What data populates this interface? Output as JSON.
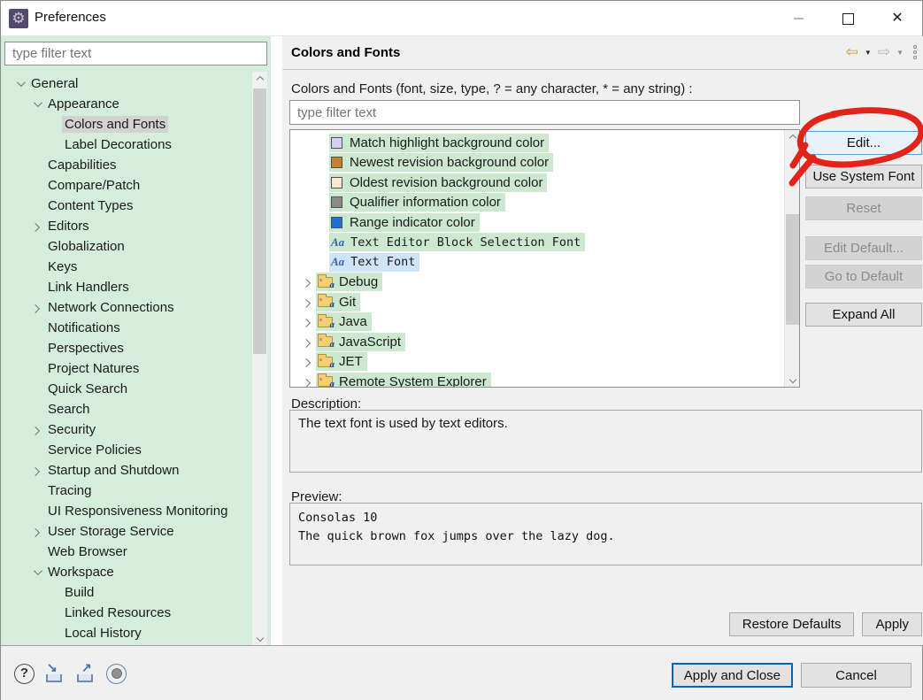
{
  "titlebar": {
    "title": "Preferences",
    "app_icon_glyph": "⚙",
    "close_glyph": "✕"
  },
  "sidebar": {
    "filter_placeholder": "type filter text",
    "tree": [
      {
        "label": "General",
        "level": 0,
        "state": "expanded",
        "selected": false
      },
      {
        "label": "Appearance",
        "level": 1,
        "state": "expanded",
        "selected": false
      },
      {
        "label": "Colors and Fonts",
        "level": 2,
        "state": "none",
        "selected": true
      },
      {
        "label": "Label Decorations",
        "level": 2,
        "state": "none",
        "selected": false
      },
      {
        "label": "Capabilities",
        "level": 1,
        "state": "none",
        "selected": false
      },
      {
        "label": "Compare/Patch",
        "level": 1,
        "state": "none",
        "selected": false
      },
      {
        "label": "Content Types",
        "level": 1,
        "state": "none",
        "selected": false
      },
      {
        "label": "Editors",
        "level": 1,
        "state": "collapsed",
        "selected": false
      },
      {
        "label": "Globalization",
        "level": 1,
        "state": "none",
        "selected": false
      },
      {
        "label": "Keys",
        "level": 1,
        "state": "none",
        "selected": false
      },
      {
        "label": "Link Handlers",
        "level": 1,
        "state": "none",
        "selected": false
      },
      {
        "label": "Network Connections",
        "level": 1,
        "state": "collapsed",
        "selected": false
      },
      {
        "label": "Notifications",
        "level": 1,
        "state": "none",
        "selected": false
      },
      {
        "label": "Perspectives",
        "level": 1,
        "state": "none",
        "selected": false
      },
      {
        "label": "Project Natures",
        "level": 1,
        "state": "none",
        "selected": false
      },
      {
        "label": "Quick Search",
        "level": 1,
        "state": "none",
        "selected": false
      },
      {
        "label": "Search",
        "level": 1,
        "state": "none",
        "selected": false
      },
      {
        "label": "Security",
        "level": 1,
        "state": "collapsed",
        "selected": false
      },
      {
        "label": "Service Policies",
        "level": 1,
        "state": "none",
        "selected": false
      },
      {
        "label": "Startup and Shutdown",
        "level": 1,
        "state": "collapsed",
        "selected": false
      },
      {
        "label": "Tracing",
        "level": 1,
        "state": "none",
        "selected": false
      },
      {
        "label": "UI Responsiveness Monitoring",
        "level": 1,
        "state": "none",
        "selected": false
      },
      {
        "label": "User Storage Service",
        "level": 1,
        "state": "collapsed",
        "selected": false
      },
      {
        "label": "Web Browser",
        "level": 1,
        "state": "none",
        "selected": false
      },
      {
        "label": "Workspace",
        "level": 1,
        "state": "expanded",
        "selected": false
      },
      {
        "label": "Build",
        "level": 2,
        "state": "none",
        "selected": false
      },
      {
        "label": "Linked Resources",
        "level": 2,
        "state": "none",
        "selected": false
      },
      {
        "label": "Local History",
        "level": 2,
        "state": "none",
        "selected": false
      }
    ]
  },
  "content": {
    "page_title": "Colors and Fonts",
    "toolbar": {
      "back_glyph": "⇦",
      "forward_glyph": "⇨",
      "dropdown_glyph": "▼"
    },
    "filter_label": "Colors and Fonts (font, size, type, ? = any character, * = any string) :",
    "filter_placeholder": "type filter text",
    "font_icon_glyph": "Aa",
    "folder_badge": "a",
    "list": [
      {
        "type": "color",
        "label": "Match highlight background color",
        "swatch": "#d7cef2",
        "highlight": "green"
      },
      {
        "type": "color",
        "label": "Newest revision background color",
        "swatch": "#c4802c",
        "highlight": "green"
      },
      {
        "type": "color",
        "label": "Oldest revision background color",
        "swatch": "#f9e9d2",
        "highlight": "green"
      },
      {
        "type": "color",
        "label": "Qualifier information color",
        "swatch": "#8a8a8a",
        "highlight": "green"
      },
      {
        "type": "color",
        "label": "Range indicator color",
        "swatch": "#1c72d4",
        "highlight": "green"
      },
      {
        "type": "font",
        "label": "Text Editor Block Selection Font",
        "highlight": "green"
      },
      {
        "type": "font",
        "label": "Text Font",
        "highlight": "blue"
      },
      {
        "type": "category",
        "label": "Debug",
        "highlight": "green"
      },
      {
        "type": "category",
        "label": "Git",
        "highlight": "green"
      },
      {
        "type": "category",
        "label": "Java",
        "highlight": "green"
      },
      {
        "type": "category",
        "label": "JavaScript",
        "highlight": "green"
      },
      {
        "type": "category",
        "label": "JET",
        "highlight": "green"
      },
      {
        "type": "category",
        "label": "Remote System Explorer",
        "highlight": "green"
      }
    ],
    "side_buttons": [
      {
        "label": "Edit...",
        "style": "focus"
      },
      {
        "label": "Use System Font",
        "style": "normal"
      },
      {
        "label": "Reset",
        "style": "disabled"
      },
      {
        "label": "Edit Default...",
        "style": "disabled"
      },
      {
        "label": "Go to Default",
        "style": "disabled"
      },
      {
        "label": "Expand All",
        "style": "normal"
      }
    ],
    "description_label": "Description:",
    "description_text": "The text font is used by text editors.",
    "preview_label": "Preview:",
    "preview_lines": [
      "Consolas 10",
      "The quick brown fox jumps over the lazy dog."
    ],
    "footer_buttons": [
      {
        "label": "Restore Defaults"
      },
      {
        "label": "Apply"
      }
    ]
  },
  "bottom_bar": {
    "help_glyph": "?",
    "import_glyph": "↘",
    "export_glyph": "↗",
    "buttons": [
      {
        "label": "Apply and Close",
        "default": true
      },
      {
        "label": "Cancel",
        "default": false
      }
    ]
  },
  "annotation": {
    "color": "#e2231a",
    "target": "Edit... button",
    "shape": "hand-drawn ellipse"
  }
}
